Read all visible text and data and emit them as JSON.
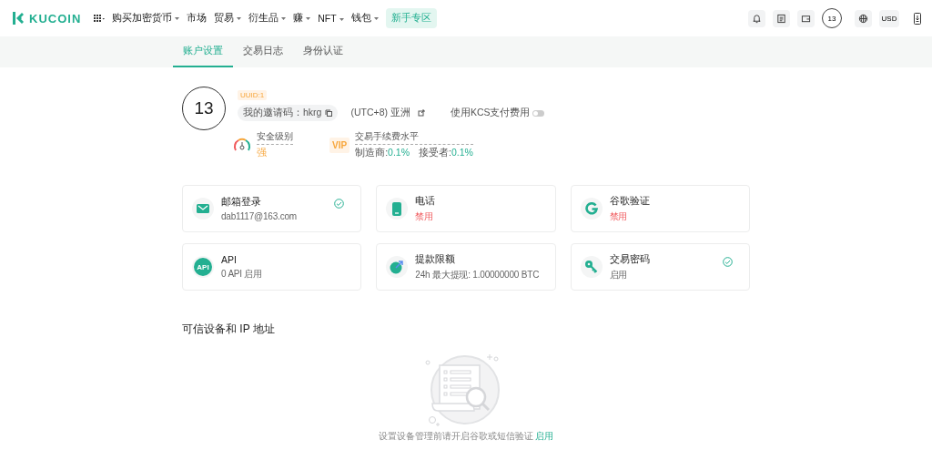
{
  "nav": {
    "logo": "KUCOIN",
    "menu": [
      {
        "label": "购买加密货币",
        "dropdown": true
      },
      {
        "label": "市场",
        "dropdown": false
      },
      {
        "label": "贸易",
        "dropdown": true
      },
      {
        "label": "衍生品",
        "dropdown": true
      },
      {
        "label": "赚",
        "dropdown": true
      },
      {
        "label": "NFT",
        "dropdown": true
      },
      {
        "label": "钱包",
        "dropdown": true
      }
    ],
    "promo": "新手专区",
    "avatar": "13",
    "currency": "USD"
  },
  "tabs": [
    {
      "label": "账户设置",
      "selected": true
    },
    {
      "label": "交易日志",
      "selected": false
    },
    {
      "label": "身份认证",
      "selected": false
    }
  ],
  "profile": {
    "avatar": "13",
    "uuid": "UUID:1",
    "invite": "我的邀请码：hkrg",
    "timezone": "(UTC+8) 亚洲",
    "kcs_label": "使用KCS支付费用",
    "kcs_on": false,
    "security_label": "安全级别",
    "security_value": "强",
    "vip_badge": "VIP",
    "fee_label": "交易手续费水平",
    "maker_label": "制造商:",
    "maker_value": "0.1%",
    "taker_label": "接受者:",
    "taker_value": "0.1%"
  },
  "cards": [
    {
      "kind": "email",
      "title": "邮箱登录",
      "detail": "dab1117@163.com",
      "enabled": true,
      "verified": true
    },
    {
      "kind": "phone",
      "title": "电话",
      "detail": "禁用",
      "enabled": false,
      "verified": false
    },
    {
      "kind": "google",
      "title": "谷歌验证",
      "detail": "禁用",
      "enabled": false,
      "verified": false
    },
    {
      "kind": "api",
      "icon_label": "API",
      "title": "API",
      "detail": "0 API 启用",
      "enabled": true,
      "verified": false
    },
    {
      "kind": "withdraw",
      "title": "提款限额",
      "detail": "24h 最大提现: 1.00000000 BTC",
      "enabled": true,
      "verified": false
    },
    {
      "kind": "key",
      "title": "交易密码",
      "detail": "启用",
      "enabled": true,
      "verified": true
    }
  ],
  "devices": {
    "title": "可信设备和 IP 地址",
    "empty_text": "设置设备管理前请开启谷歌或短信验证",
    "empty_link": "启用"
  }
}
